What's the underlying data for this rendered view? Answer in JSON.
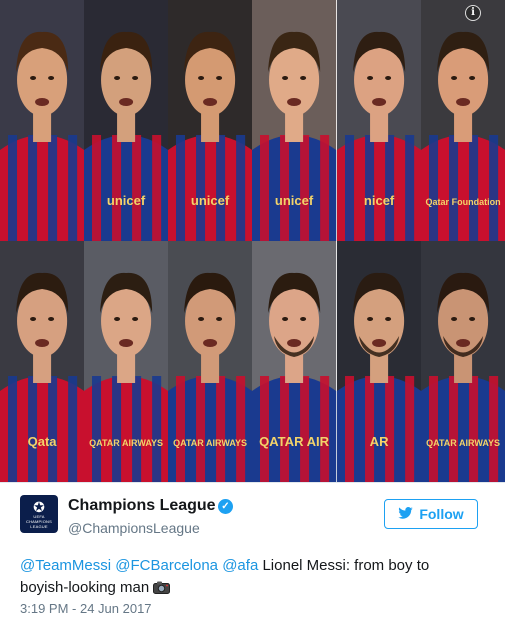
{
  "photo_grid": {
    "info_glyph": "i",
    "cells": [
      {
        "shirt": "#c8102e",
        "shirt2": "#1a3a8f",
        "skin": "#d8a07a",
        "hair": "#4a2a14",
        "bg": "#3a3a48",
        "text": ""
      },
      {
        "shirt": "#1a3a8f",
        "shirt2": "#c8102e",
        "skin": "#d3a07c",
        "hair": "#3a2210",
        "bg": "#2a2a34",
        "text": "unicef"
      },
      {
        "shirt": "#c8102e",
        "shirt2": "#1a3a8f",
        "skin": "#d49a72",
        "hair": "#3d2412",
        "bg": "#2e2a2a",
        "text": "unicef"
      },
      {
        "shirt": "#1a3a8f",
        "shirt2": "#c8102e",
        "skin": "#e0aa88",
        "hair": "#3a2614",
        "bg": "#6b5e5a",
        "text": "unicef"
      },
      {
        "shirt": "#c8102e",
        "shirt2": "#1a3a8f",
        "skin": "#dca282",
        "hair": "#2e1e12",
        "bg": "#4a4a52",
        "text": "nicef"
      },
      {
        "shirt": "#c8102e",
        "shirt2": "#1a3a8f",
        "skin": "#d99c78",
        "hair": "#2f1f12",
        "bg": "#3b3a3e",
        "text": "Qatar Foundation"
      },
      {
        "shirt": "#c8102e",
        "shirt2": "#1a3a8f",
        "skin": "#d6a080",
        "hair": "#2c1c10",
        "bg": "#3a3a42",
        "text": "Qata"
      },
      {
        "shirt": "#c8102e",
        "shirt2": "#1a3a8f",
        "skin": "#dba686",
        "hair": "#2c1e12",
        "bg": "#5a5c64",
        "text": "QATAR AIRWAYS"
      },
      {
        "shirt": "#1a3a8f",
        "shirt2": "#c8102e",
        "skin": "#d19a78",
        "hair": "#2a1a0e",
        "bg": "#4a4c52",
        "text": "QATAR AIRWAYS"
      },
      {
        "shirt": "#1a3a8f",
        "shirt2": "#c8102e",
        "skin": "#dca588",
        "hair": "#2b1c10",
        "bg": "#6a6a70",
        "text": "QATAR AIR"
      },
      {
        "shirt": "#1a3a8f",
        "shirt2": "#c8102e",
        "skin": "#d4a07e",
        "hair": "#2a1c12",
        "bg": "#2a2c34",
        "text": "AR"
      },
      {
        "shirt": "#1a3a8f",
        "shirt2": "#c8102e",
        "skin": "#c99474",
        "hair": "#2a1a10",
        "bg": "#34363e",
        "text": "QATAR AIRWAYS"
      }
    ]
  },
  "tweet": {
    "author_name": "Champions League",
    "handle": "@ChampionsLeague",
    "follow_label": "Follow",
    "mention_1": "@TeamMessi",
    "mention_2": "@FCBarcelona",
    "mention_3": "@afa",
    "text_line_1": " Lionel Messi: from boy to",
    "text_line_2": "boyish-looking man ",
    "timestamp": "3:19 PM - 24 Jun 2017",
    "avatar_text": "UEFA CHAMPIONS LEAGUE"
  },
  "colors": {
    "twitter_blue": "#1da1f2",
    "link_blue": "#1b95e0",
    "text_dark": "#14171a",
    "text_grey": "#657786"
  }
}
